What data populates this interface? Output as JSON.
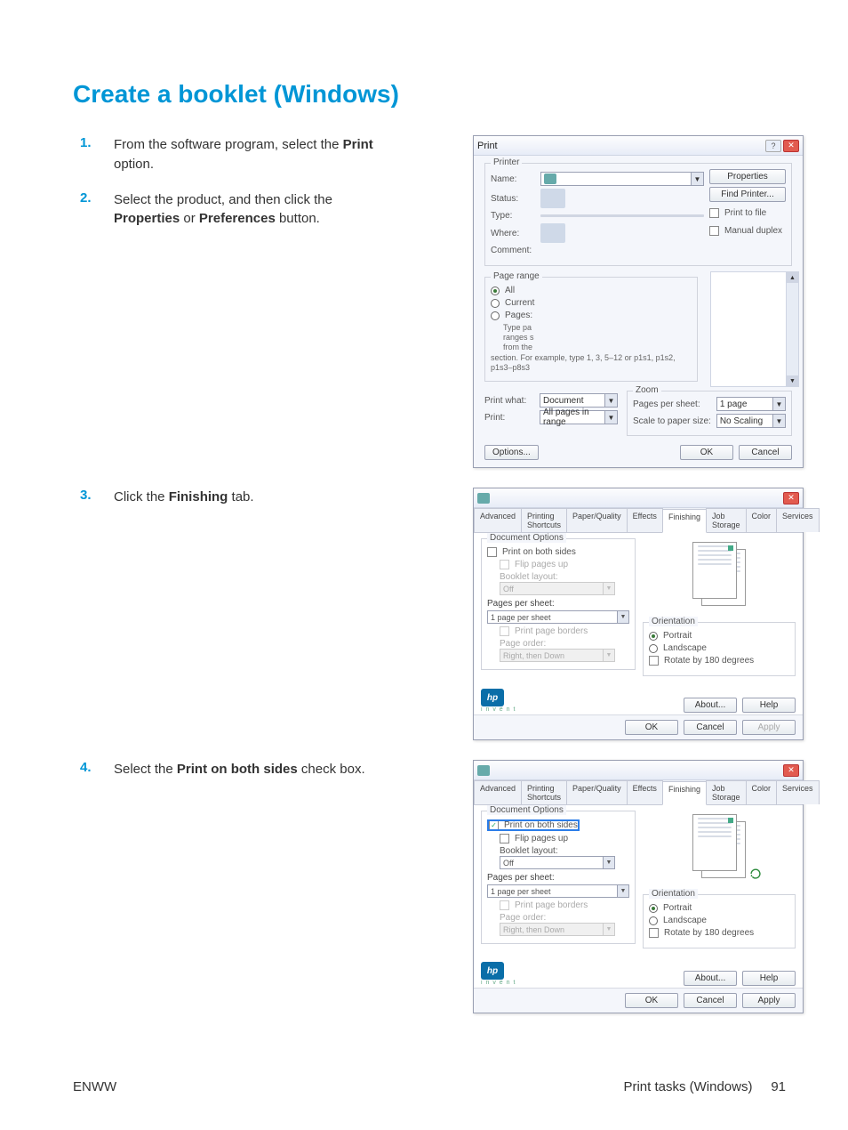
{
  "heading": "Create a booklet (Windows)",
  "steps": {
    "s1": {
      "num": "1.",
      "pre": "From the software program, select the ",
      "b1": "Print",
      "post": " option."
    },
    "s2": {
      "num": "2.",
      "pre": "Select the product, and then click the ",
      "b1": "Properties",
      "mid": " or ",
      "b2": "Preferences",
      "post": " button."
    },
    "s3": {
      "num": "3.",
      "pre": "Click the ",
      "b1": "Finishing",
      "post": " tab."
    },
    "s4": {
      "num": "4.",
      "pre": "Select the ",
      "b1": "Print on both sides",
      "post": " check box."
    }
  },
  "printDialog": {
    "title": "Print",
    "printerGroup": "Printer",
    "name": "Name:",
    "status": "Status:",
    "type": "Type:",
    "where": "Where:",
    "comment": "Comment:",
    "properties": "Properties",
    "findPrinter": "Find Printer...",
    "printToFile": "Print to file",
    "manualDuplex": "Manual duplex",
    "pageRange": "Page range",
    "all": "All",
    "current": "Current",
    "pages": "Pages:",
    "rangeHint1": "Type pa",
    "rangeHint2": "ranges s",
    "rangeHint3": "from the",
    "hintTail": "section. For example, type 1, 3, 5–12 or p1s1, p1s2, p1s3–p8s3",
    "printWhat": "Print what:",
    "printWhatVal": "Document",
    "print": "Print:",
    "printVal": "All pages in range",
    "zoom": "Zoom",
    "pps": "Pages per sheet:",
    "ppsVal": "1 page",
    "scale": "Scale to paper size:",
    "scaleVal": "No Scaling",
    "options": "Options...",
    "ok": "OK",
    "cancel": "Cancel"
  },
  "props": {
    "tabs": [
      "Advanced",
      "Printing Shortcuts",
      "Paper/Quality",
      "Effects",
      "Finishing",
      "Job Storage",
      "Color",
      "Services"
    ],
    "docOptions": "Document Options",
    "printBoth": "Print on both sides",
    "flipUp": "Flip pages up",
    "bookletLayout": "Booklet layout:",
    "bookletOff": "Off",
    "ppsLabel": "Pages per sheet:",
    "ppsVal": "1 page per sheet",
    "printBorders": "Print page borders",
    "pageOrder": "Page order:",
    "pageOrderVal": "Right, then Down",
    "orientation": "Orientation",
    "portrait": "Portrait",
    "landscape": "Landscape",
    "rotate": "Rotate by 180 degrees",
    "about": "About...",
    "help": "Help",
    "ok": "OK",
    "cancel": "Cancel",
    "apply": "Apply",
    "invent": "i n v e n t"
  },
  "footer": {
    "left": "ENWW",
    "rightLabel": "Print tasks (Windows)",
    "pageNum": "91"
  }
}
